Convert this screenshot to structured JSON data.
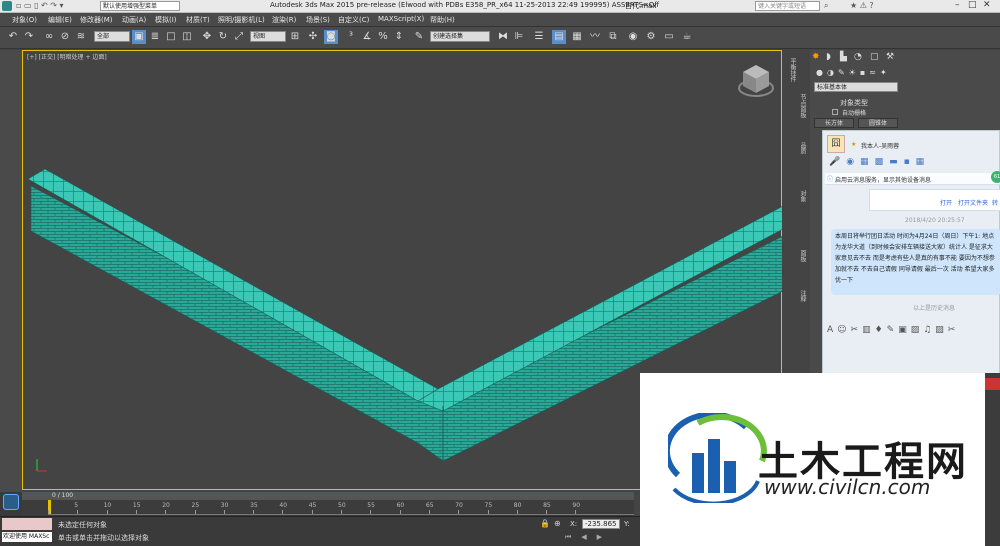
{
  "titlebar": {
    "workspace": "默认使用增强型菜单",
    "title": "Autodesk 3ds Max  2015 pre-release (Elwood with PDBs E358_PR_x64 11-25-2013 22:49 199995) ASSERTS=Off",
    "file": "古代.max",
    "search_placeholder": "键入关键字或短语"
  },
  "menu": [
    "对象(O)",
    "编辑(E)",
    "修改器(M)",
    "动画(A)",
    "模拟(I)",
    "材质(T)",
    "照明/摄影机(L)",
    "渲染(R)",
    "场景(S)",
    "自定义(C)",
    "MAXScript(X)",
    "帮助(H)"
  ],
  "toolbar": {
    "selection_filter": "全部",
    "ref_coord": "视图",
    "named_set": "创建选择集"
  },
  "viewport": {
    "label": "[+] [正交] [明暗处理 + 边面]"
  },
  "right_panel": {
    "dropdown": "标准基本体",
    "rollout_title": "对象类型",
    "autogrid": "自动栅格",
    "buttons": [
      "长方体",
      "圆锥体"
    ],
    "side_tabs": [
      "平衡挂件",
      "节点面板",
      "品质",
      "对象",
      "面板",
      "注释"
    ]
  },
  "chat": {
    "contact": "我本人-吴雨蓉",
    "notice": "启用云消息服务，显示其他设备消息",
    "links": [
      "打开",
      "打开文件夹",
      "转"
    ],
    "timestamp": "2018/4/20 20:25:57",
    "message": "本周日将举行团日活动 时间为4月24日（周日）下午1: 地点为龙华大道（到时候会安排车辆接送大家）统计人 是征求大家意见去不去 而是考虑有些人是真的有事不能 要因为不想参加就不去 不去自己请假 同导请假 最后一次 活动 希望大家多优一下",
    "history": "以上是历史消息"
  },
  "logo": {
    "brand": "土木工程网",
    "url": "www.civilcn.com"
  },
  "timeline": {
    "frame": "0 / 100",
    "ticks": [
      "5",
      "10",
      "15",
      "20",
      "25",
      "30",
      "35",
      "40",
      "45",
      "50",
      "55",
      "60",
      "65",
      "70",
      "75",
      "80",
      "85",
      "90"
    ]
  },
  "status": {
    "line1": "未选定任何对象",
    "line2": "单击或单击并拖动以选择对象",
    "welcome": "欢迎使用 MAXSc",
    "x_label": "X:",
    "x_value": "-235.865",
    "y_label": "Y:"
  },
  "colors": {
    "wall": "#2fb8a8",
    "viewport_border": "#e8c200",
    "logo_blue": "#1a5fb0"
  }
}
